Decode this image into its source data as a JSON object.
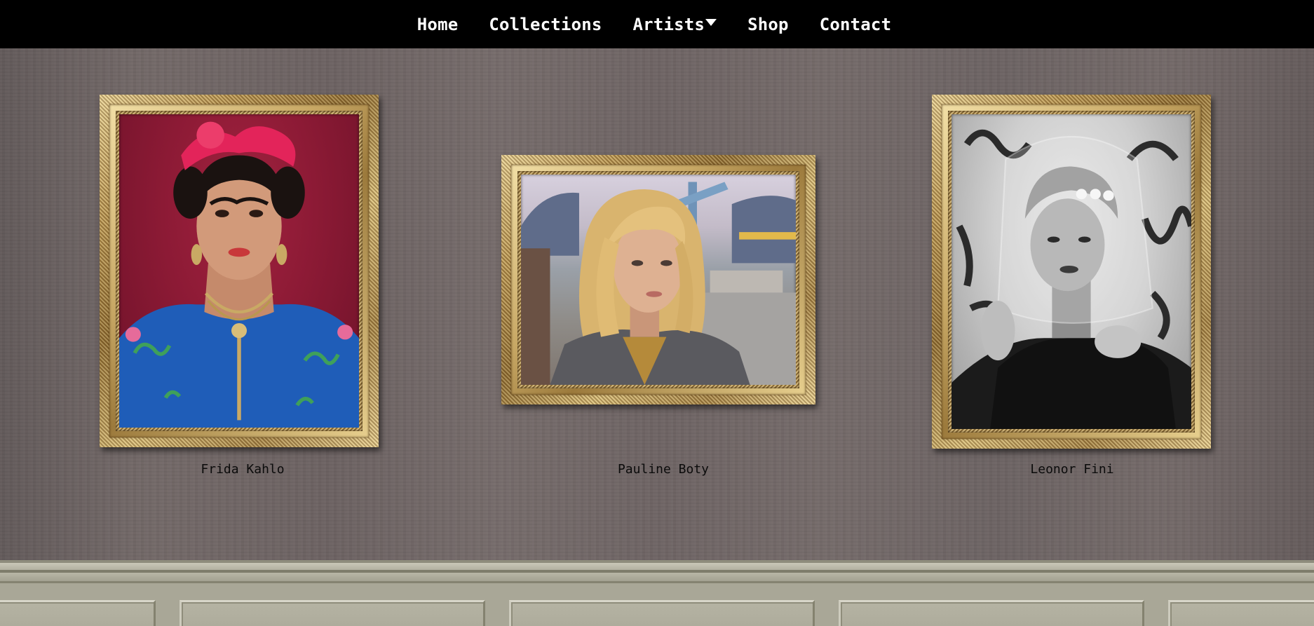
{
  "nav": {
    "items": [
      {
        "label": "Home"
      },
      {
        "label": "Collections"
      },
      {
        "label": "Artists",
        "has_dropdown": true
      },
      {
        "label": "Shop"
      },
      {
        "label": "Contact"
      }
    ]
  },
  "gallery": {
    "artists": [
      {
        "name": "Frida Kahlo"
      },
      {
        "name": "Pauline Boty"
      },
      {
        "name": "Leonor Fini"
      }
    ]
  },
  "colors": {
    "nav_background": "#000000",
    "nav_text": "#ffffff",
    "wall": "#6e6463",
    "frame_gold": "#c8a865",
    "wainscot": "#a9a797"
  },
  "icons": {
    "artists_dropdown": "caret-down-icon"
  }
}
